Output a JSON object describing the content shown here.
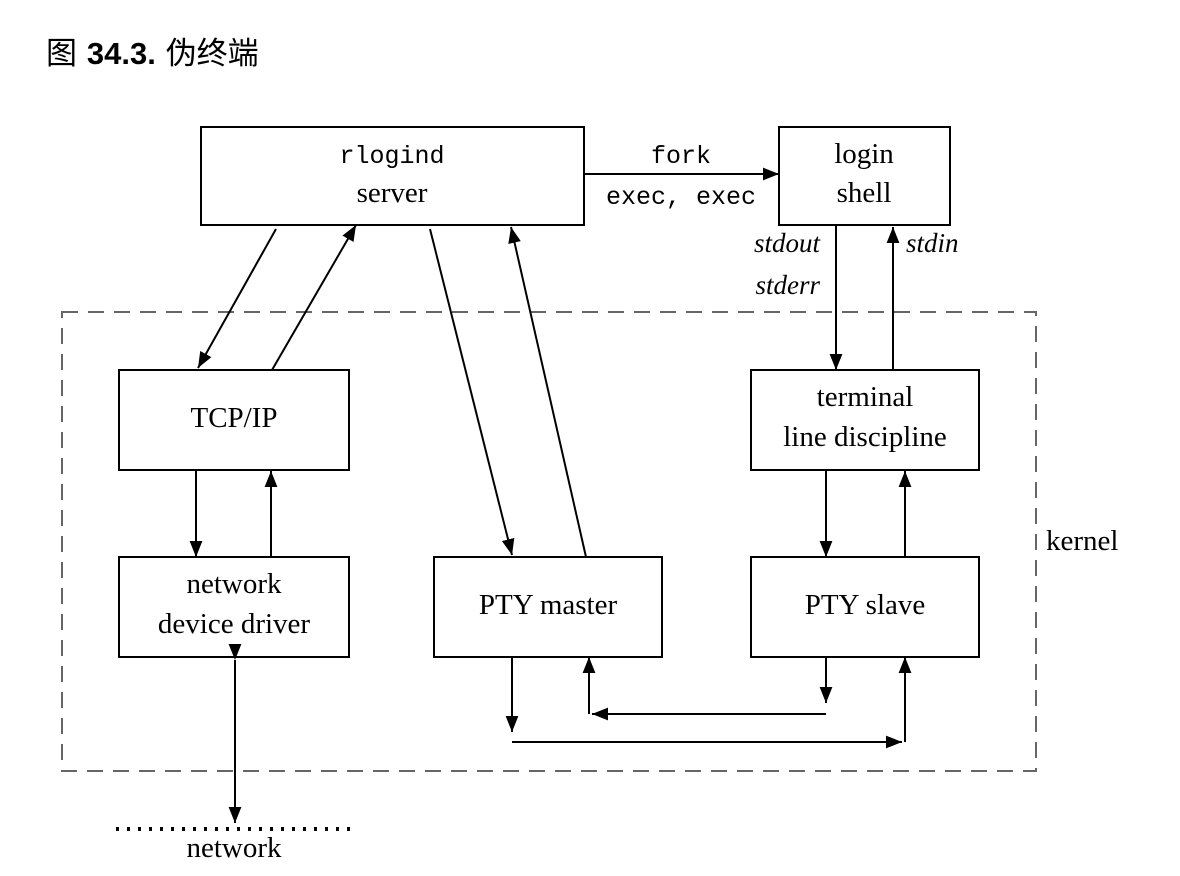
{
  "title": {
    "prefix": "图",
    "number": "34.3.",
    "text": "伪终端"
  },
  "nodes": {
    "rlogind": {
      "line1": "rlogind",
      "line2": "server"
    },
    "login": {
      "line1": "login",
      "line2": "shell"
    },
    "tcpip": {
      "line1": "TCP/IP"
    },
    "terminal": {
      "line1": "terminal",
      "line2": "line discipline"
    },
    "netdrv": {
      "line1": "network",
      "line2": "device driver"
    },
    "ptymaster": {
      "line1": "PTY master"
    },
    "ptyslave": {
      "line1": "PTY slave"
    }
  },
  "labels": {
    "fork": "fork",
    "exec": "exec, exec",
    "stdout": "stdout",
    "stderr": "stderr",
    "stdin": "stdin",
    "kernel": "kernel",
    "network": "network"
  }
}
